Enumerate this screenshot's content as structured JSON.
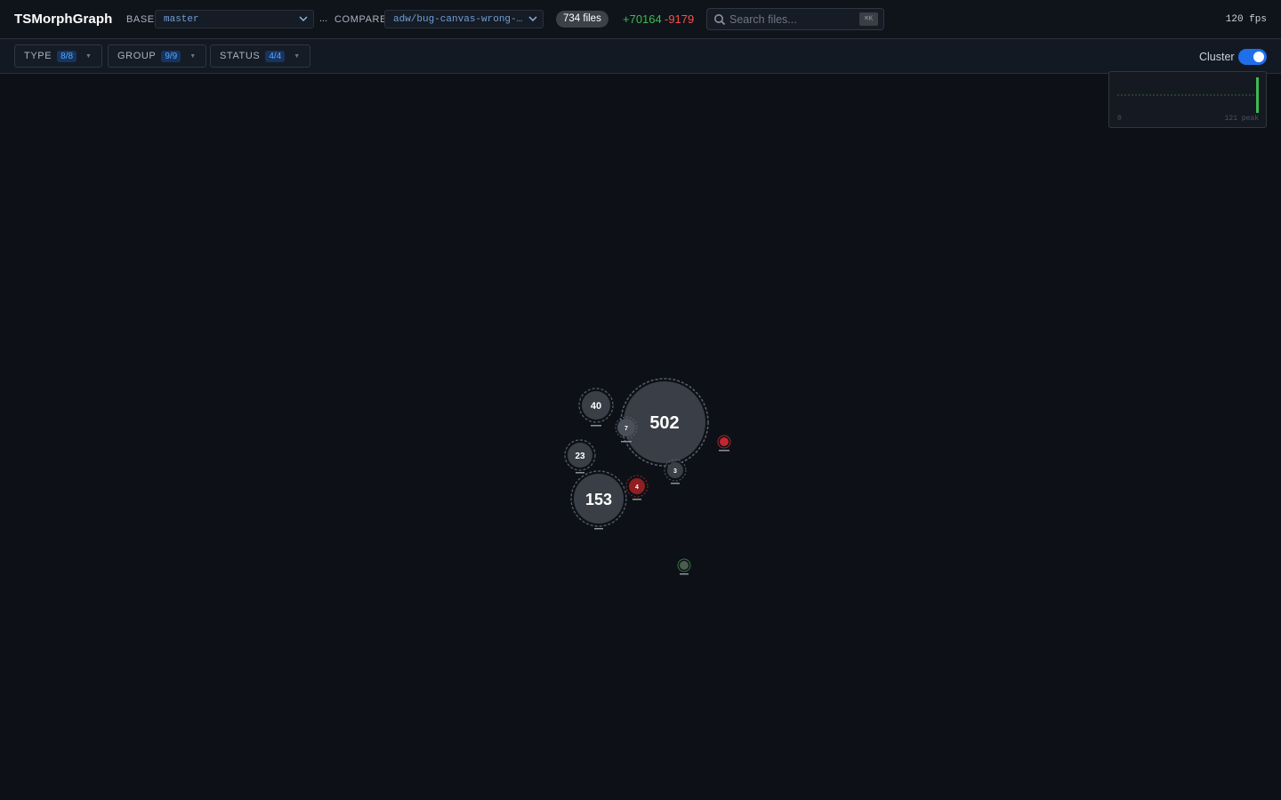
{
  "app": {
    "title": "TSMorphGraph"
  },
  "header": {
    "base_label": "BASE",
    "base_value": "master",
    "separator": "...",
    "compare_label": "COMPARE",
    "compare_value": "adw/bug-canvas-wrong-…",
    "files_count": "734 files",
    "additions": "+70164",
    "deletions": "-9179",
    "search_placeholder": "Search files...",
    "search_shortcut": "⌘K",
    "fps": "120 fps"
  },
  "filters": [
    {
      "label": "TYPE",
      "count": "8/8"
    },
    {
      "label": "GROUP",
      "count": "9/9"
    },
    {
      "label": "STATUS",
      "count": "4/4"
    }
  ],
  "cluster": {
    "label": "Cluster",
    "enabled": true
  },
  "perf": {
    "min_label": "0",
    "peak_label": "121 peak"
  },
  "graph": {
    "clusters": [
      {
        "id": "c502",
        "count": "502",
        "status": "unchanged"
      },
      {
        "id": "c153",
        "count": "153",
        "status": "unchanged"
      },
      {
        "id": "c40",
        "count": "40",
        "status": "unchanged"
      },
      {
        "id": "c23",
        "count": "23",
        "status": "unchanged"
      },
      {
        "id": "c7",
        "count": "7",
        "status": "unchanged"
      },
      {
        "id": "c4",
        "count": "4",
        "status": "deleted"
      },
      {
        "id": "c3",
        "count": "3",
        "status": "unchanged"
      }
    ],
    "nodes": [
      {
        "id": "n-red",
        "status": "deleted"
      },
      {
        "id": "n-green",
        "status": "added"
      }
    ]
  },
  "colors": {
    "background": "#0d1117",
    "accent": "#1f6feb",
    "added": "#3fb950",
    "deleted": "#f85149",
    "cluster_fill": "#3a3f47"
  }
}
